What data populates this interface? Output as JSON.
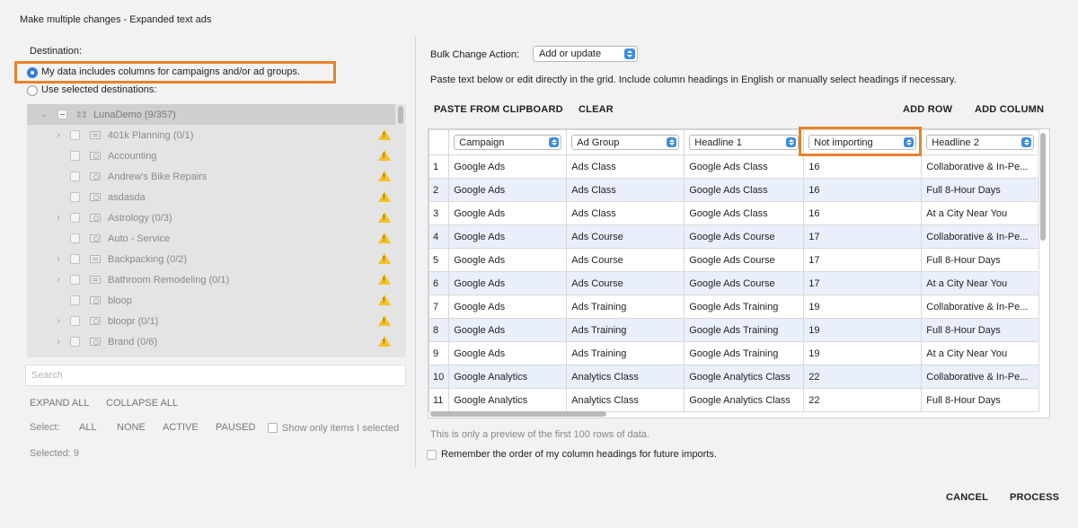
{
  "window": {
    "title": "Make multiple changes - Expanded text ads"
  },
  "destination": {
    "label": "Destination:",
    "option_columns": "My data includes columns for campaigns and/or ad groups.",
    "option_selected": "Use selected destinations:",
    "selected_option": "columns"
  },
  "tree": {
    "items": [
      {
        "label": "LunaDemo (9/357)",
        "type": "account",
        "warning": false
      },
      {
        "label": "401k Planning (0/1)",
        "type": "campaign",
        "warning": true
      },
      {
        "label": "Accounting",
        "type": "adgroup",
        "warning": true
      },
      {
        "label": "Andrew's Bike Repairs",
        "type": "adgroup",
        "warning": true
      },
      {
        "label": "asdasda",
        "type": "adgroup",
        "warning": true
      },
      {
        "label": "Astrology (0/3)",
        "type": "campaign",
        "warning": true
      },
      {
        "label": "Auto - Service",
        "type": "adgroup",
        "warning": true
      },
      {
        "label": "Backpacking (0/2)",
        "type": "campaign",
        "warning": true
      },
      {
        "label": "Bathroom Remodeling (0/1)",
        "type": "campaign",
        "warning": true
      },
      {
        "label": "bloop",
        "type": "adgroup",
        "warning": true
      },
      {
        "label": "bloopr (0/1)",
        "type": "campaign",
        "warning": true
      },
      {
        "label": "Brand (0/6)",
        "type": "campaign",
        "warning": true
      }
    ],
    "search_placeholder": "Search",
    "expand_all": "EXPAND ALL",
    "collapse_all": "COLLAPSE ALL",
    "select_label": "Select:",
    "select_all": "ALL",
    "select_none": "NONE",
    "select_active": "ACTIVE",
    "select_paused": "PAUSED",
    "show_only_selected": "Show only items I selected",
    "selected_count": "Selected: 9"
  },
  "bulk": {
    "action_label": "Bulk Change Action:",
    "action_value": "Add or update",
    "instructions": "Paste text below or edit directly in the grid. Include column headings in English or manually select headings if necessary.",
    "paste_button": "PASTE FROM CLIPBOARD",
    "clear_button": "CLEAR",
    "add_row_button": "ADD ROW",
    "add_column_button": "ADD COLUMN"
  },
  "grid": {
    "headers": [
      "Campaign",
      "Ad Group",
      "Headline 1",
      "Not importing",
      "Headline 2"
    ],
    "rows": [
      [
        "1",
        "Google Ads",
        "Ads Class",
        "Google Ads Class",
        "16",
        "Collaborative & In-Pe..."
      ],
      [
        "2",
        "Google Ads",
        "Ads Class",
        "Google Ads Class",
        "16",
        "Full 8-Hour Days"
      ],
      [
        "3",
        "Google Ads",
        "Ads Class",
        "Google Ads Class",
        "16",
        "At a City Near You"
      ],
      [
        "4",
        "Google Ads",
        "Ads Course",
        "Google Ads Course",
        "17",
        "Collaborative & In-Pe..."
      ],
      [
        "5",
        "Google Ads",
        "Ads Course",
        "Google Ads Course",
        "17",
        "Full 8-Hour Days"
      ],
      [
        "6",
        "Google Ads",
        "Ads Course",
        "Google Ads Course",
        "17",
        "At a City Near You"
      ],
      [
        "7",
        "Google Ads",
        "Ads Training",
        "Google Ads Training",
        "19",
        "Collaborative & In-Pe..."
      ],
      [
        "8",
        "Google Ads",
        "Ads Training",
        "Google Ads Training",
        "19",
        "Full 8-Hour Days"
      ],
      [
        "9",
        "Google Ads",
        "Ads Training",
        "Google Ads Training",
        "19",
        "At a City Near You"
      ],
      [
        "10",
        "Google Analytics",
        "Analytics Class",
        "Google Analytics Class",
        "22",
        "Collaborative & In-Pe..."
      ],
      [
        "11",
        "Google Analytics",
        "Analytics Class",
        "Google Analytics Class",
        "22",
        "Full 8-Hour Days"
      ]
    ],
    "preview_note": "This is only a preview of the first 100 rows of data.",
    "remember_order": "Remember the order of my column headings for future imports."
  },
  "footer": {
    "cancel": "CANCEL",
    "process": "PROCESS"
  },
  "colors": {
    "highlight": "#e8822a",
    "accent": "#3d8ce0",
    "row_alt": "#e9f0fb",
    "warning": "#f3c22a"
  }
}
